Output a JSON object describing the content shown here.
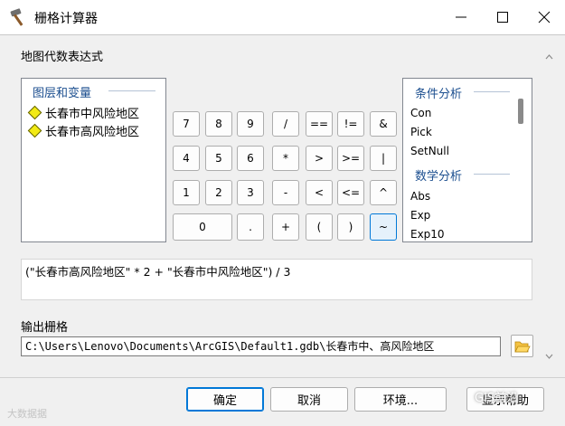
{
  "window": {
    "title": "栅格计算器"
  },
  "section_label": "地图代数表达式",
  "layers": {
    "heading": "图层和变量",
    "items": [
      {
        "label": "长春市中风险地区"
      },
      {
        "label": "长春市高风险地区"
      }
    ]
  },
  "keypad": {
    "rows": [
      [
        "7",
        "8",
        "9",
        "/",
        "==",
        "!=",
        "&"
      ],
      [
        "4",
        "5",
        "6",
        "*",
        ">",
        ">=",
        "|"
      ],
      [
        "1",
        "2",
        "3",
        "-",
        "<",
        "<=",
        "^"
      ],
      [
        "0",
        ".",
        "+",
        "(",
        ")",
        "~"
      ]
    ]
  },
  "functions": {
    "group1": "条件分析",
    "group1_items": [
      "Con",
      "Pick",
      "SetNull"
    ],
    "group2": "数学分析",
    "group2_items": [
      "Abs",
      "Exp",
      "Exp10"
    ]
  },
  "expression": "(\"长春市高风险地区\" * 2 + \"长春市中风险地区\") / 3",
  "output": {
    "label": "输出栅格",
    "value": "C:\\Users\\Lenovo\\Documents\\ArcGIS\\Default1.gdb\\长春市中、高风险地区"
  },
  "buttons": {
    "ok": "确定",
    "cancel": "取消",
    "env": "环境...",
    "help": "显示帮助"
  },
  "watermarks": {
    "left": "大数据据",
    "right": "GIS前沿"
  },
  "colors": {
    "accent": "#0078d7",
    "group_heading": "#1b4e8f",
    "layer_symbol": "#f2ea14"
  }
}
